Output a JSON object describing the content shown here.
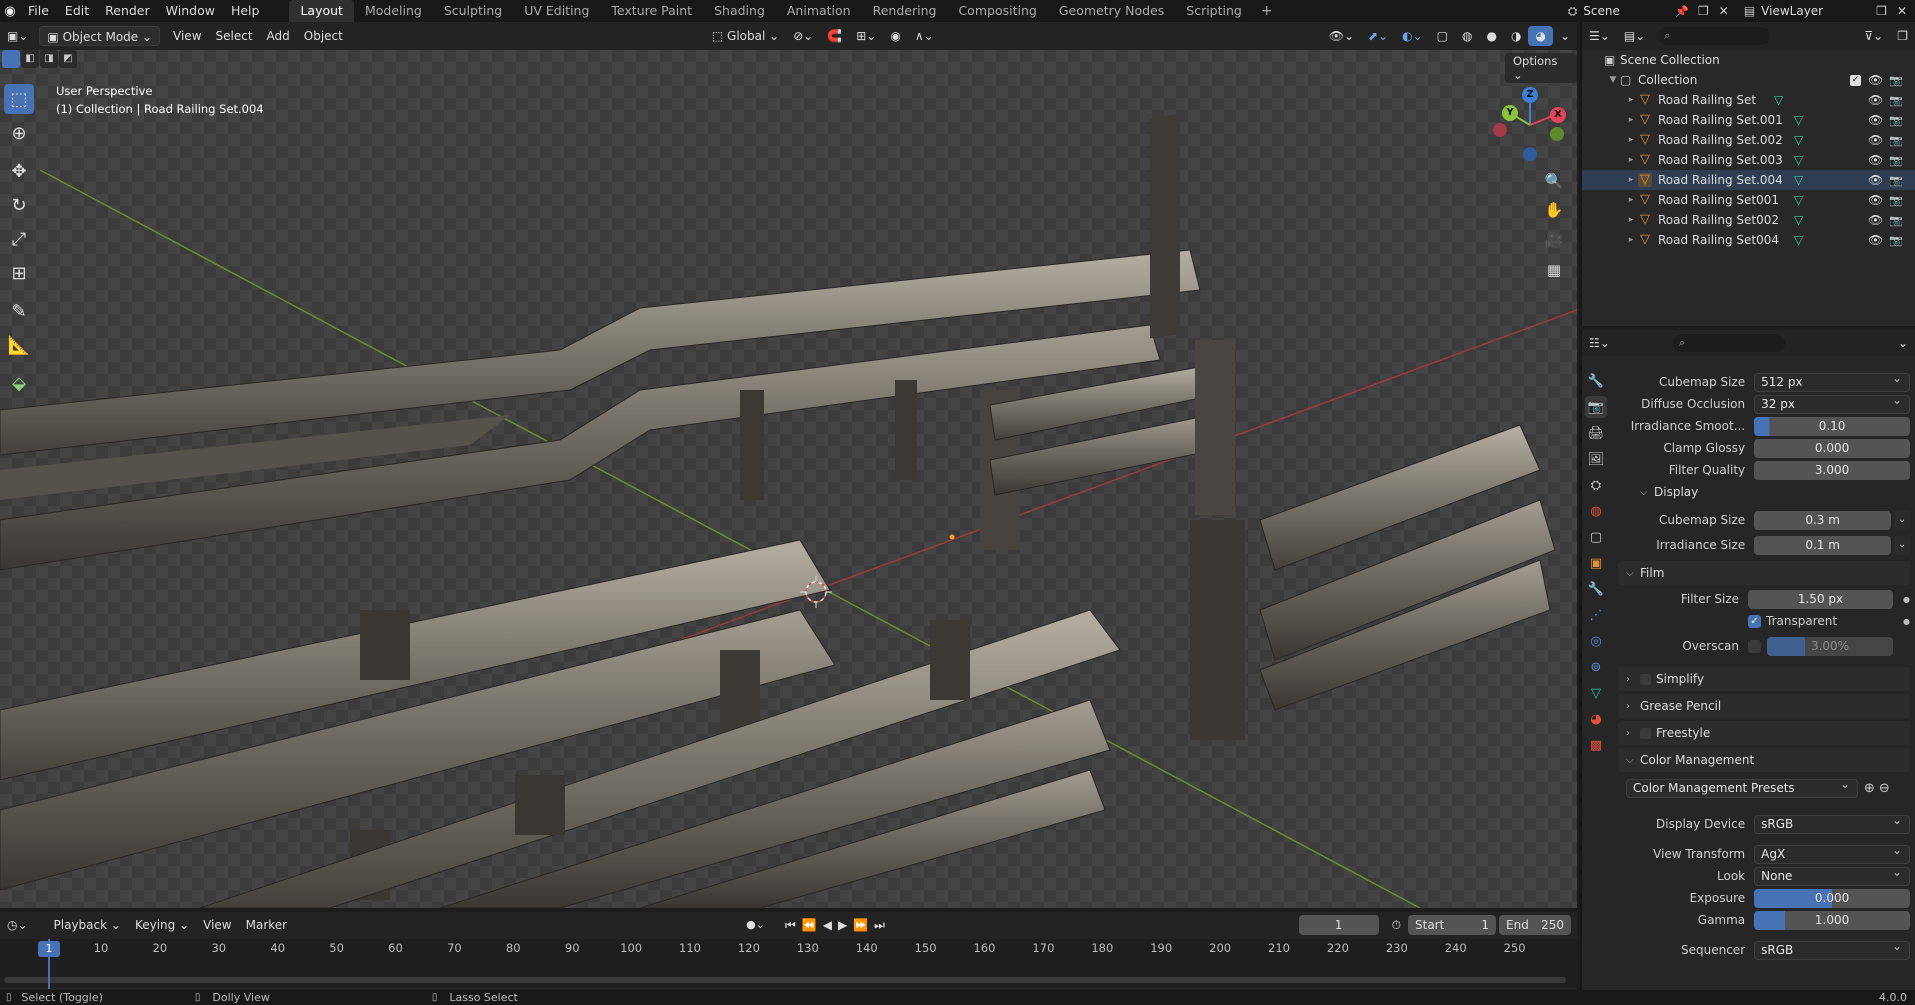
{
  "topbar": {
    "menus": [
      "File",
      "Edit",
      "Render",
      "Window",
      "Help"
    ],
    "workspaces": [
      "Layout",
      "Modeling",
      "Sculpting",
      "UV Editing",
      "Texture Paint",
      "Shading",
      "Animation",
      "Rendering",
      "Compositing",
      "Geometry Nodes",
      "Scripting"
    ],
    "active_workspace": "Layout",
    "scene_label": "Scene",
    "viewlayer_label": "ViewLayer"
  },
  "viewport_header": {
    "mode": "Object Mode",
    "menus": [
      "View",
      "Select",
      "Add",
      "Object"
    ],
    "orientation": "Global",
    "options_label": "Options"
  },
  "viewport": {
    "perspective_label": "User Perspective",
    "collection_info": "(1) Collection | Road Railing Set.004",
    "gizmo_axes": [
      "Z",
      "Y",
      "X"
    ]
  },
  "outliner": {
    "scene_collection": "Scene Collection",
    "collection": "Collection",
    "items": [
      {
        "name": "Road Railing Set",
        "selected": false
      },
      {
        "name": "Road Railing Set.001",
        "selected": false
      },
      {
        "name": "Road Railing Set.002",
        "selected": false
      },
      {
        "name": "Road Railing Set.003",
        "selected": false
      },
      {
        "name": "Road Railing Set.004",
        "selected": true
      },
      {
        "name": "Road Railing Set001",
        "selected": false
      },
      {
        "name": "Road Railing Set002",
        "selected": false
      },
      {
        "name": "Road Railing Set004",
        "selected": false
      }
    ]
  },
  "properties": {
    "rows": {
      "cubemap_size_label": "Cubemap Size",
      "cubemap_size": "512 px",
      "diffuse_occlusion_label": "Diffuse Occlusion",
      "diffuse_occlusion": "32 px",
      "irradiance_smooth_label": "Irradiance Smoot...",
      "irradiance_smooth": "0.10",
      "clamp_glossy_label": "Clamp Glossy",
      "clamp_glossy": "0.000",
      "filter_quality_label": "Filter Quality",
      "filter_quality": "3.000"
    },
    "display_section": "Display",
    "display": {
      "cubemap_size_label": "Cubemap Size",
      "cubemap_size": "0.3 m",
      "irradiance_size_label": "Irradiance Size",
      "irradiance_size": "0.1 m"
    },
    "film_section": "Film",
    "film": {
      "filter_size_label": "Filter Size",
      "filter_size": "1.50 px",
      "transparent_label": "Transparent",
      "transparent": true,
      "overscan_label": "Overscan",
      "overscan": "3.00%"
    },
    "simplify_section": "Simplify",
    "grease_pencil_section": "Grease Pencil",
    "freestyle_section": "Freestyle",
    "color_management_section": "Color Management",
    "color_management": {
      "presets_label": "Color Management Presets",
      "display_device_label": "Display Device",
      "display_device": "sRGB",
      "view_transform_label": "View Transform",
      "view_transform": "AgX",
      "look_label": "Look",
      "look": "None",
      "exposure_label": "Exposure",
      "exposure": "0.000",
      "gamma_label": "Gamma",
      "gamma": "1.000",
      "sequencer_label": "Sequencer",
      "sequencer": "sRGB"
    }
  },
  "timeline": {
    "menus": [
      "Playback",
      "Keying",
      "View",
      "Marker"
    ],
    "current_frame": "1",
    "start_label": "Start",
    "start": "1",
    "end_label": "End",
    "end": "250",
    "ticks": [
      "1",
      "10",
      "20",
      "30",
      "40",
      "50",
      "60",
      "70",
      "80",
      "90",
      "100",
      "110",
      "120",
      "130",
      "140",
      "150",
      "160",
      "170",
      "180",
      "190",
      "200",
      "210",
      "220",
      "230",
      "240",
      "250"
    ]
  },
  "statusbar": {
    "select_toggle": "Select (Toggle)",
    "dolly_view": "Dolly View",
    "lasso_select": "Lasso Select",
    "version": "4.0.0"
  },
  "colors": {
    "accent": "#4772b3",
    "object_orange": "#e0903c",
    "mesh_green": "#38c9a0",
    "x_axis": "#e2455a",
    "y_axis": "#8ac43f",
    "z_axis": "#3f7fd6"
  },
  "icons": {
    "blender": "blender-logo-icon",
    "select": "select-box-icon",
    "cursor": "cursor-icon",
    "move": "move-icon",
    "rotate": "rotate-icon",
    "scale": "scale-icon",
    "transform": "transform-icon",
    "annotate": "annotate-icon",
    "measure": "measure-icon",
    "add_cube": "add-cube-icon",
    "eye": "eye-icon",
    "camera": "camera-icon",
    "filter": "filter-icon",
    "search": "search-icon",
    "zoom": "zoom-icon",
    "hand": "pan-hand-icon",
    "camera_view": "camera-view-icon",
    "grid": "ortho-grid-icon"
  }
}
